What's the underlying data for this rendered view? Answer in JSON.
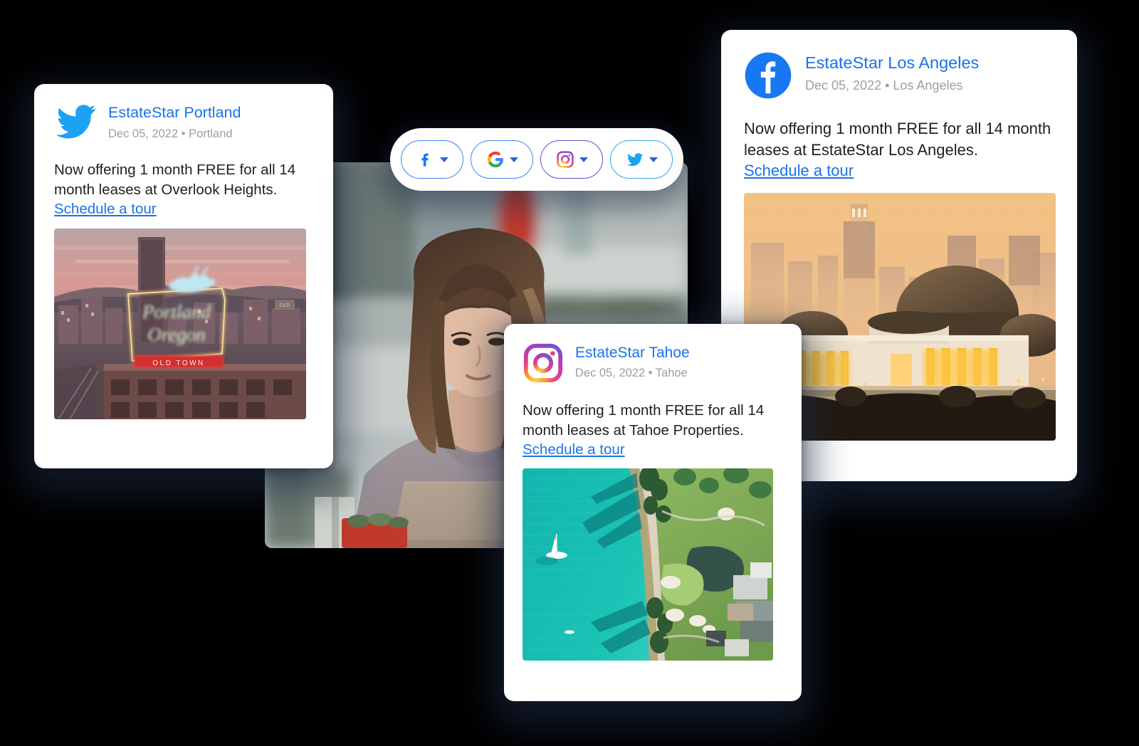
{
  "background": {
    "color": "#000000"
  },
  "network_selector": {
    "name": "social-network-selector",
    "options": [
      {
        "id": "facebook",
        "label": "Facebook",
        "icon": "facebook-icon",
        "border_color": "#4285f4",
        "caret": "chevron-down-icon"
      },
      {
        "id": "google",
        "label": "Google",
        "icon": "google-icon",
        "border_color": "#4285f4",
        "caret": "chevron-down-icon"
      },
      {
        "id": "instagram",
        "label": "Instagram",
        "icon": "instagram-icon",
        "border_color": "#6c4ad0",
        "caret": "chevron-down-icon"
      },
      {
        "id": "twitter",
        "label": "Twitter",
        "icon": "twitter-icon",
        "border_color": "#31a6f0",
        "caret": "chevron-down-icon"
      }
    ]
  },
  "center_photo": {
    "name": "woman-at-laptop-photo",
    "alt": "Woman with brown hair and bangs working on a laptop at an outdoor cafe"
  },
  "posts": [
    {
      "id": "portland",
      "network": "twitter",
      "icon": "twitter-icon",
      "account": "EstateStar Portland",
      "date": "Dec 05, 2022",
      "separator": "•",
      "location": "Portland",
      "meta": "Dec 05, 2022 • Portland",
      "body": "Now offering 1 month FREE for all 14 month leases at Overlook Heights.",
      "link_label": "Schedule a tour",
      "image_alt": "Portland Oregon Old Town neon sign at sunset"
    },
    {
      "id": "los-angeles",
      "network": "facebook",
      "icon": "facebook-icon",
      "account": "EstateStar Los Angeles",
      "date": "Dec 05, 2022",
      "separator": "•",
      "location": "Los Angeles",
      "meta": "Dec 05, 2022 • Los Angeles",
      "body": "Now offering 1 month FREE for all 14 month leases at EstateStar Los Angeles.",
      "link_label": "Schedule a tour",
      "image_alt": "Griffith Observatory with the Los Angeles skyline at golden sunset"
    },
    {
      "id": "tahoe",
      "network": "instagram",
      "icon": "instagram-icon",
      "account": "EstateStar Tahoe",
      "date": "Dec 05, 2022",
      "separator": "•",
      "location": "Tahoe",
      "meta": "Dec 05, 2022 • Tahoe",
      "body_line1": "Now offering 1 month FREE for all 14",
      "body_line2": "month leases at Tahoe Properties.",
      "link_label": "Schedule a tour",
      "image_alt": "Aerial view of Lake Tahoe turquoise shoreline with a sailboat and golf course"
    }
  ],
  "colors": {
    "link": "#1a73e8",
    "meta_text": "#9aa0a6",
    "body_text": "#1f1f1f",
    "card_background": "#ffffff",
    "facebook_blue": "#1877f2",
    "twitter_blue": "#1da1f2"
  }
}
